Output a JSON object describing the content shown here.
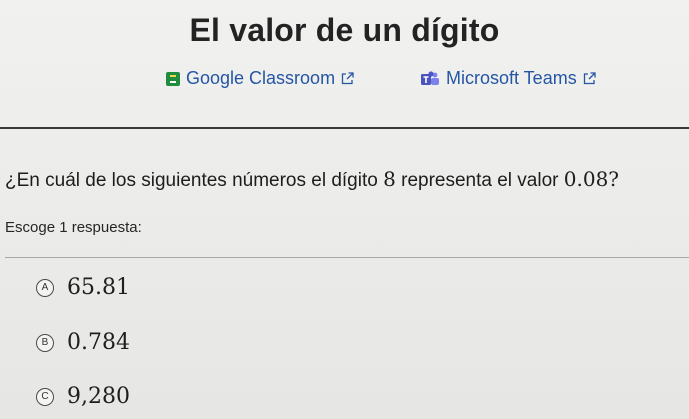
{
  "page": {
    "title": "El valor de un dígito"
  },
  "share": {
    "google_classroom": {
      "label": "Google Classroom",
      "icon": "google-classroom-icon"
    },
    "microsoft_teams": {
      "label": "Microsoft Teams",
      "icon": "microsoft-teams-icon"
    },
    "external_icon": "external-link-icon"
  },
  "question": {
    "prefix": "¿En cuál de los siguientes números el dígito ",
    "digit": "8",
    "middle": " representa el valor ",
    "value": "0.08?"
  },
  "instruction": "Escoge 1 respuesta:",
  "options": [
    {
      "letter": "A",
      "value": "65.81"
    },
    {
      "letter": "B",
      "value": "0.784"
    },
    {
      "letter": "C",
      "value": "9,280"
    }
  ],
  "colors": {
    "link": "#2456a5",
    "google_classroom_green": "#1e8e3e",
    "teams_purple": "#5059c9"
  }
}
